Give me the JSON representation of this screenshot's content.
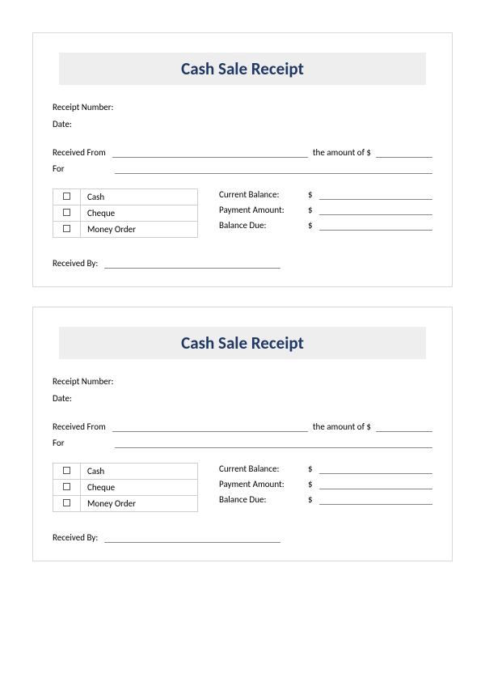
{
  "title": "Cash Sale Receipt",
  "fields": {
    "receipt_number_label": "Receipt Number:",
    "date_label": "Date:",
    "received_from_label": "Received From",
    "amount_of_label": "the amount of $",
    "for_label": "For",
    "received_by_label": "Received By:"
  },
  "payment_methods": [
    {
      "label": "Cash"
    },
    {
      "label": "Cheque"
    },
    {
      "label": "Money Order"
    }
  ],
  "balances": {
    "current_label": "Current Balance:",
    "payment_label": "Payment Amount:",
    "due_label": "Balance Due:",
    "symbol": "$"
  }
}
